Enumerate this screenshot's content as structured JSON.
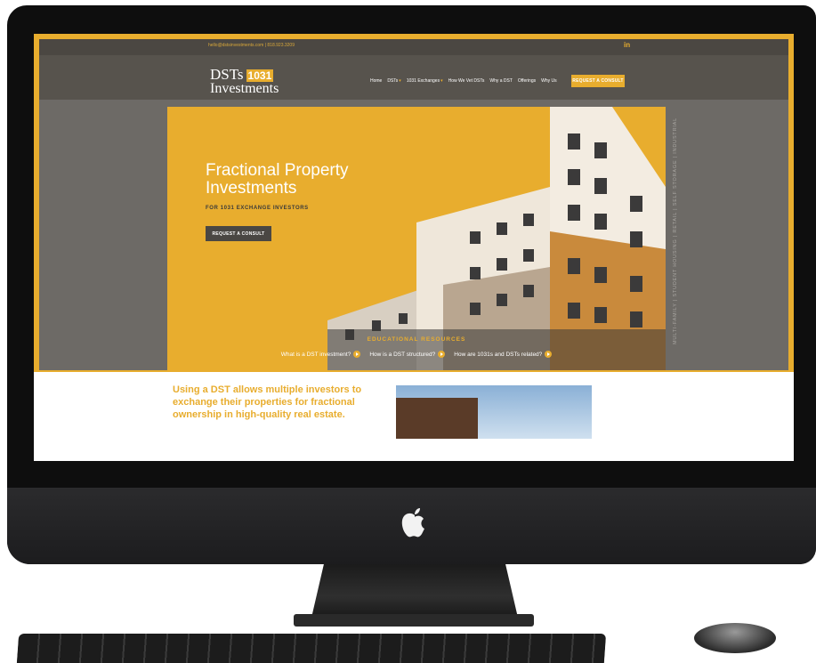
{
  "topbar": {
    "contact": "hello@dstsinvestments.com  |  818.923.3209",
    "linkedin": "in"
  },
  "logo": {
    "dsts": "DSTs",
    "number": "1031",
    "investments": "Investments"
  },
  "nav": {
    "items": [
      {
        "label": "Home",
        "caret": false
      },
      {
        "label": "DSTs",
        "caret": true
      },
      {
        "label": "1031 Exchanges",
        "caret": true
      },
      {
        "label": "How We Vet DSTs",
        "caret": false
      },
      {
        "label": "Why a DST",
        "caret": false
      },
      {
        "label": "Offerings",
        "caret": false
      },
      {
        "label": "Why Us",
        "caret": false
      }
    ],
    "cta": "REQUEST A CONSULT",
    "caret_glyph": "▾"
  },
  "hero": {
    "title": "Fractional Property Investments",
    "subtitle": "FOR 1031 EXCHANGE INVESTORS",
    "button": "REQUEST A CONSULT",
    "side_text": "MULTI-FAMILY  |  STUDENT HOUSING  |  RETAIL  |  SELF STORAGE  |  INDUSTRIAL"
  },
  "edu": {
    "title": "EDUCATIONAL RESOURCES",
    "links": [
      "What is a DST investment?",
      "How is a DST structured?",
      "How are 1031s and DSTs related?"
    ]
  },
  "intro": {
    "text": "Using a DST allows multiple investors to exchange their properties for fractional ownership in high-quality real estate."
  },
  "colors": {
    "accent": "#e8ad2e",
    "header": "#57534d",
    "dark": "#4a4743"
  },
  "icons": {
    "brand": "apple-logo-icon",
    "social": "linkedin-icon",
    "play": "play-icon",
    "caret": "caret-down-icon"
  }
}
